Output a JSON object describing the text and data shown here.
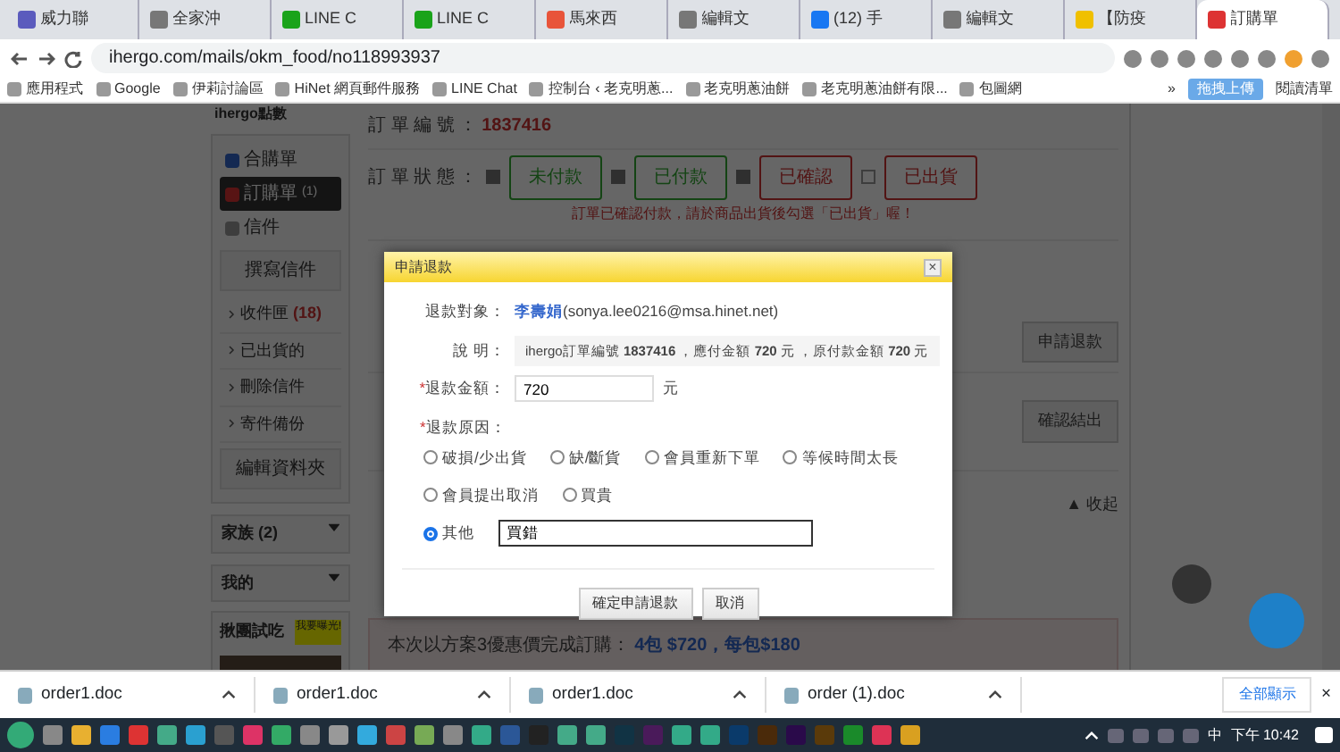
{
  "browser": {
    "tabs": [
      {
        "label": "威力聯",
        "selected": false
      },
      {
        "label": "全家沖",
        "selected": false
      },
      {
        "label": "LINE C",
        "selected": false
      },
      {
        "label": "LINE C",
        "selected": false
      },
      {
        "label": "馬來西",
        "selected": false
      },
      {
        "label": "編輯文",
        "selected": false
      },
      {
        "label": "(12) 手",
        "selected": false
      },
      {
        "label": "編輯文",
        "selected": false
      },
      {
        "label": "【防疫",
        "selected": false
      },
      {
        "label": "訂購單",
        "selected": true
      }
    ],
    "address": "ihergo.com/mails/okm_food/no118993937",
    "bookmarks": [
      "應用程式",
      "Google",
      "伊莉討論區",
      "HiNet 網頁郵件服務",
      "LINE Chat",
      "控制台 ‹ 老克明蔥...",
      "老克明蔥油餅",
      "老克明蔥油餅有限...",
      "包圖網"
    ],
    "more_bookmarks": "»",
    "upload_button": "拖拽上傳",
    "reading_list": "閱讀清單"
  },
  "sidebar": {
    "points_title": "ihergo點數",
    "nav": [
      {
        "label": "合購單",
        "selected": false
      },
      {
        "label": "訂購單",
        "count": "(1)",
        "selected": true
      },
      {
        "label": "信件",
        "selected": false
      }
    ],
    "compose_button": "撰寫信件",
    "folders": [
      {
        "label": "收件匣",
        "count": "(18)"
      },
      {
        "label": "已出貨的"
      },
      {
        "label": "刪除信件"
      },
      {
        "label": "寄件備份"
      }
    ],
    "edit_folders_button": "編輯資料夾",
    "groups": [
      "家族 (2)",
      "我的"
    ],
    "tasting": {
      "title": "揪團試吃",
      "badge": "我要曝光!"
    }
  },
  "order": {
    "number_label": "訂 單 編 號 ：",
    "number": "1837416",
    "status_label": "訂 單 狀 態 ：",
    "statuses": [
      {
        "label": "未付款",
        "disabled": true
      },
      {
        "label": "已付款",
        "disabled": true
      },
      {
        "label": "已確認",
        "disabled": true
      },
      {
        "label": "已出貨",
        "disabled": false
      }
    ],
    "note": "訂單已確認付款，請於商品出貨後勾選「已出貨」喔！",
    "refund_button": "申請退款",
    "confirm_button": "確認結出",
    "collapse": "▲ 收起",
    "summary": "本次以方案3優惠價完成訂購：",
    "summary_price": "4包 $720，每包$180"
  },
  "dialog": {
    "title": "申請退款",
    "close": "×",
    "target_label": "退款對象：",
    "target_name": "李壽娟",
    "target_email": "(sonya.lee0216@msa.hinet.net)",
    "desc_label": "說 明：",
    "desc": "ihergo訂單編號 **1837416** ，應付金額 **720** 元 ，原付款金額 **720** 元",
    "amount_label": "*退款金額：",
    "amount": "720",
    "amount_unit": "元",
    "reason_label": "*退款原因：",
    "reasons": [
      {
        "label": "破損/少出貨",
        "selected": false
      },
      {
        "label": "缺/斷貨",
        "selected": false
      },
      {
        "label": "會員重新下單",
        "selected": false
      },
      {
        "label": "等候時間太長",
        "selected": false
      },
      {
        "label": "會員提出取消",
        "selected": false
      },
      {
        "label": "買貴",
        "selected": false
      },
      {
        "label": "其他",
        "selected": true
      }
    ],
    "other_value": "買錯",
    "buttons": [
      "確定申請退款",
      "取消"
    ]
  },
  "downloads": {
    "files": [
      "order1.doc",
      "order1.doc",
      "order1.doc",
      "order (1).doc"
    ],
    "show_all": "全部顯示",
    "close": "×"
  },
  "taskbar": {
    "ime": "中",
    "clock": "下午 10:42"
  }
}
